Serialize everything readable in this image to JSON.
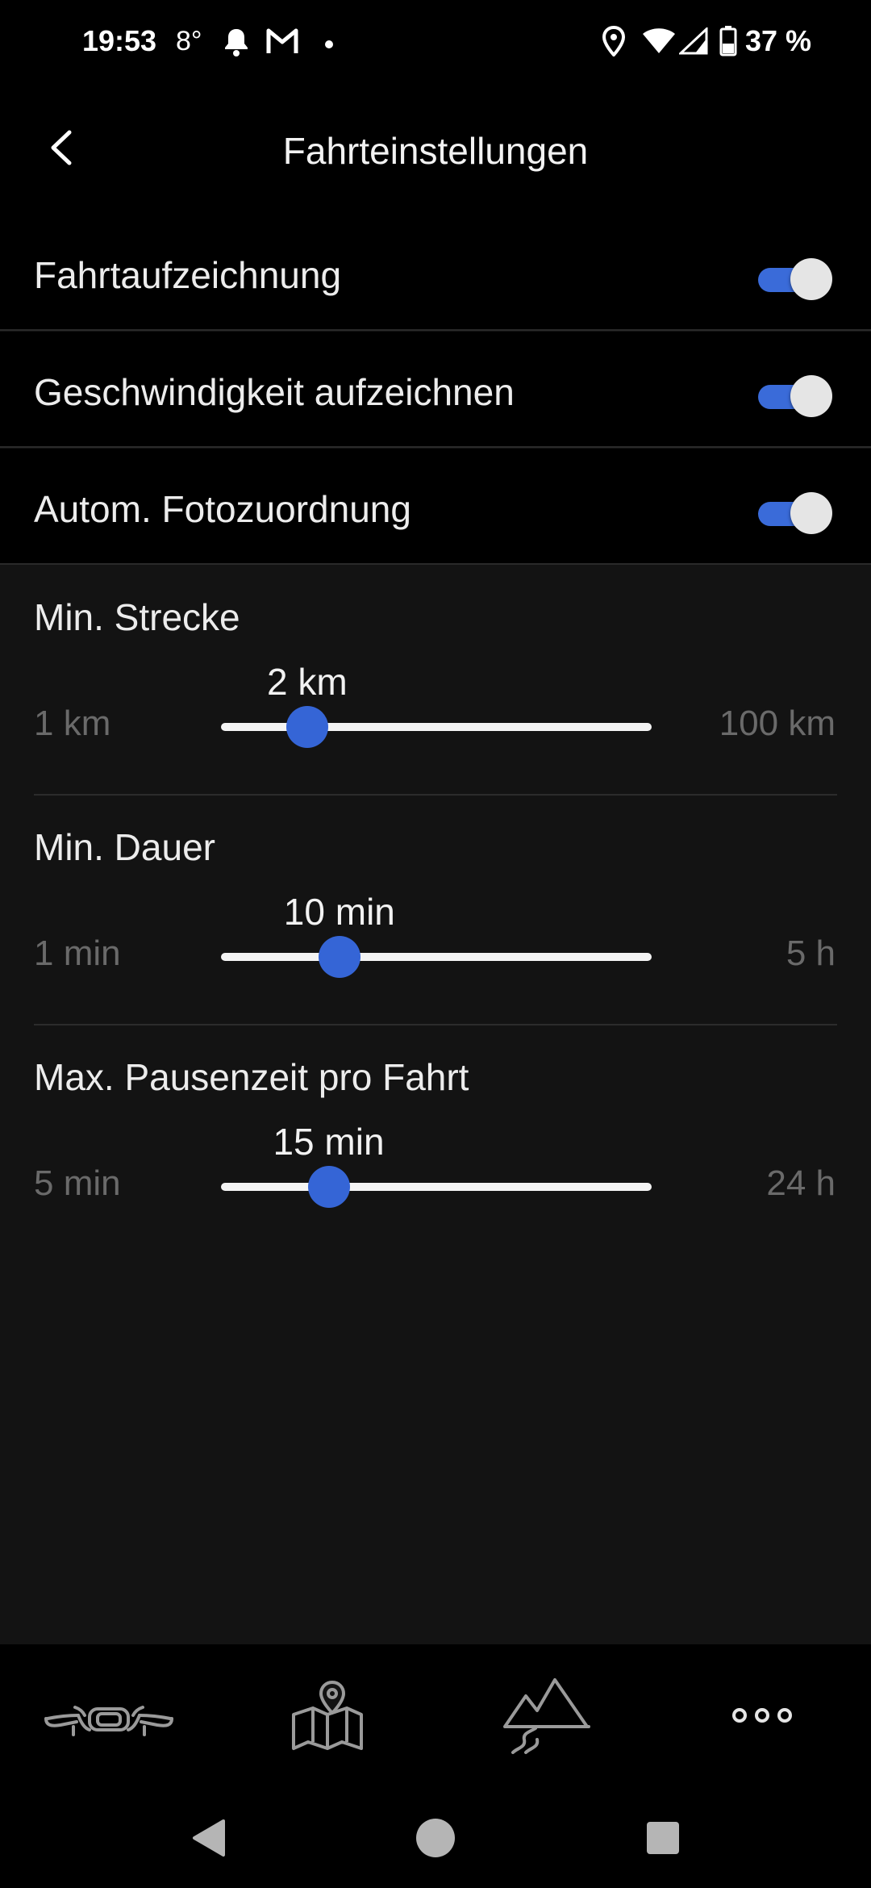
{
  "status_bar": {
    "time": "19:53",
    "temperature": "8°",
    "battery_text": "37 %",
    "icons": [
      "bell-icon",
      "gmail-icon",
      "dot-icon",
      "location-icon",
      "wifi-icon",
      "signal-icon",
      "battery-icon"
    ]
  },
  "header": {
    "title": "Fahrteinstellungen",
    "back_icon": "chevron-left-icon"
  },
  "toggles": [
    {
      "label": "Fahrtaufzeichnung",
      "on": true
    },
    {
      "label": "Geschwindigkeit aufzeichnen",
      "on": true
    },
    {
      "label": "Autom. Fotozuordnung",
      "on": true
    }
  ],
  "sliders": [
    {
      "title": "Min. Strecke",
      "min_label": "1 km",
      "max_label": "100 km",
      "value_label": "2 km",
      "fraction": 0.2
    },
    {
      "title": "Min. Dauer",
      "min_label": "1 min",
      "max_label": "5 h",
      "value_label": "10 min",
      "fraction": 0.275
    },
    {
      "title": "Max. Pausenzeit pro Fahrt",
      "min_label": "5 min",
      "max_label": "24 h",
      "value_label": "15 min",
      "fraction": 0.25
    }
  ],
  "bottom_nav": {
    "items": [
      "scooter-icon",
      "map-pin-icon",
      "mountain-route-icon",
      "more-icon"
    ]
  },
  "colors": {
    "accent": "#3565d6",
    "background": "#131313",
    "row_background": "#000000",
    "muted_text": "#6a6a6a"
  }
}
